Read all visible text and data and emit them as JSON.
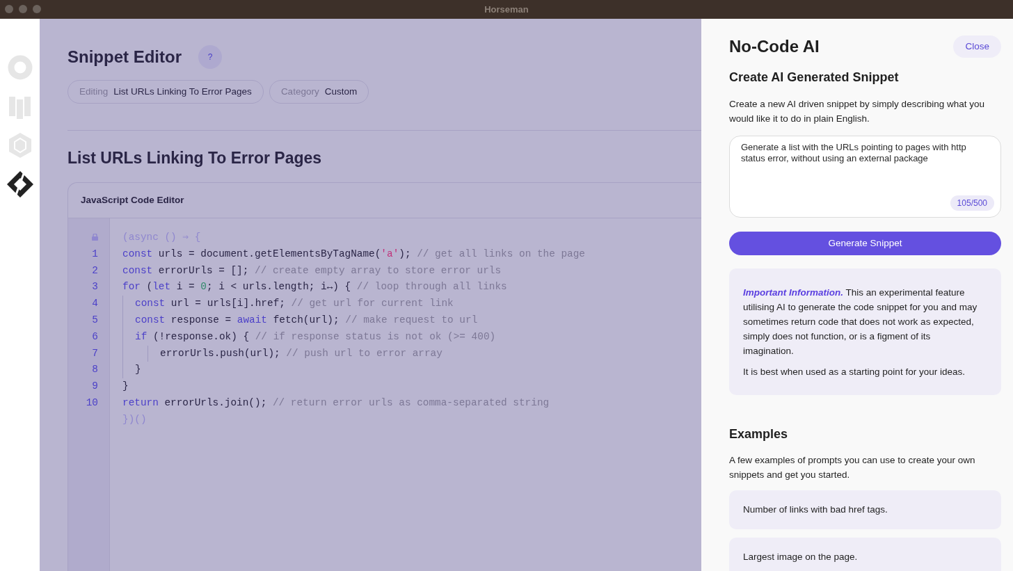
{
  "window": {
    "title": "Horseman"
  },
  "sidebar": {
    "items": [
      {
        "selected": false
      },
      {
        "selected": false
      },
      {
        "selected": false
      },
      {
        "selected": true
      }
    ]
  },
  "editor": {
    "title": "Snippet Editor",
    "help_button": "?",
    "chips": [
      {
        "label": "Editing",
        "value": "List URLs Linking To Error Pages"
      },
      {
        "label": "Category",
        "value": "Custom"
      }
    ],
    "heading": "List URLs Linking To Error Pages",
    "code_editor": {
      "title": "JavaScript Code Editor",
      "lines": [
        {
          "kind": "locked",
          "tokens": [
            {
              "kind": "plain",
              "text": "(async () ⇒ {"
            }
          ]
        },
        {
          "number": "1",
          "kind": "code",
          "tokens": [
            {
              "kind": "kw",
              "text": "const"
            },
            {
              "kind": "plain",
              "text": " urls = document.getElementsByTagName("
            },
            {
              "kind": "str",
              "text": "'a'"
            },
            {
              "kind": "plain",
              "text": ");"
            },
            {
              "kind": "cmt",
              "text": " // get all links on the page"
            }
          ]
        },
        {
          "number": "2",
          "kind": "code",
          "tokens": [
            {
              "kind": "kw",
              "text": "const"
            },
            {
              "kind": "plain",
              "text": " errorUrls = [];"
            },
            {
              "kind": "cmt",
              "text": " // create empty array to store error urls"
            }
          ]
        },
        {
          "number": "3",
          "kind": "code",
          "tokens": [
            {
              "kind": "kw",
              "text": "for"
            },
            {
              "kind": "plain",
              "text": " ("
            },
            {
              "kind": "kw",
              "text": "let"
            },
            {
              "kind": "plain",
              "text": " i = "
            },
            {
              "kind": "num",
              "text": "0"
            },
            {
              "kind": "plain",
              "text": "; i < urls.length; i↔) {"
            },
            {
              "kind": "cmt",
              "text": " // loop through all links"
            }
          ],
          "children": [
            {
              "number": "4",
              "kind": "code",
              "tokens": [
                {
                  "kind": "kw",
                  "text": "const"
                },
                {
                  "kind": "plain",
                  "text": " url = urls[i].href;"
                },
                {
                  "kind": "cmt",
                  "text": " // get url for current link"
                }
              ]
            },
            {
              "number": "5",
              "kind": "code",
              "tokens": [
                {
                  "kind": "kw",
                  "text": "const"
                },
                {
                  "kind": "plain",
                  "text": " response = "
                },
                {
                  "kind": "kw",
                  "text": "await"
                },
                {
                  "kind": "plain",
                  "text": " fetch(url);"
                },
                {
                  "kind": "cmt",
                  "text": " // make request to url"
                }
              ]
            },
            {
              "number": "6",
              "kind": "code",
              "tokens": [
                {
                  "kind": "kw",
                  "text": "if"
                },
                {
                  "kind": "plain",
                  "text": " (!response.ok) {"
                },
                {
                  "kind": "cmt",
                  "text": " // if response status is not ok (>= 400)"
                }
              ],
              "children": [
                {
                  "number": "7",
                  "kind": "code",
                  "tokens": [
                    {
                      "kind": "plain",
                      "text": "errorUrls.push(url);"
                    },
                    {
                      "kind": "cmt",
                      "text": " // push url to error array"
                    }
                  ]
                }
              ]
            },
            {
              "number": "8",
              "kind": "code",
              "tokens": [
                {
                  "kind": "plain",
                  "text": "}"
                }
              ]
            }
          ]
        },
        {
          "number": "9",
          "kind": "code",
          "tokens": [
            {
              "kind": "plain",
              "text": "}"
            }
          ]
        },
        {
          "number": "10",
          "kind": "code",
          "tokens": [
            {
              "kind": "kw",
              "text": "return"
            },
            {
              "kind": "plain",
              "text": " errorUrls.join();"
            },
            {
              "kind": "cmt",
              "text": " // return error urls as comma-separated string"
            }
          ]
        },
        {
          "kind": "tail",
          "tokens": [
            {
              "kind": "plain",
              "text": "})()"
            }
          ]
        }
      ]
    }
  },
  "ai_panel": {
    "title": "No-Code AI",
    "close_button": "Close",
    "subtitle": "Create AI Generated Snippet",
    "description": "Create a new AI driven snippet by simply describing what you would like it to do in plain English.",
    "prompt": {
      "value": "Generate a list with the URLs pointing to pages with http status error, without using an external package",
      "counter": "105/500"
    },
    "generate_button": "Generate Snippet",
    "notice": [
      "*Important Information.* This an experimental feature utilising AI to generate the code snippet for you and may sometimes return code that does not work as expected, simply does not function, or is a figment of its imagination.",
      "It is best when used as a starting point for your ideas."
    ],
    "examples": {
      "heading": "Examples",
      "description": "A few examples of prompts you can use to create your own snippets and get you started.",
      "items": [
        "Number of links with bad href tags.",
        "Largest image on the page."
      ]
    }
  }
}
